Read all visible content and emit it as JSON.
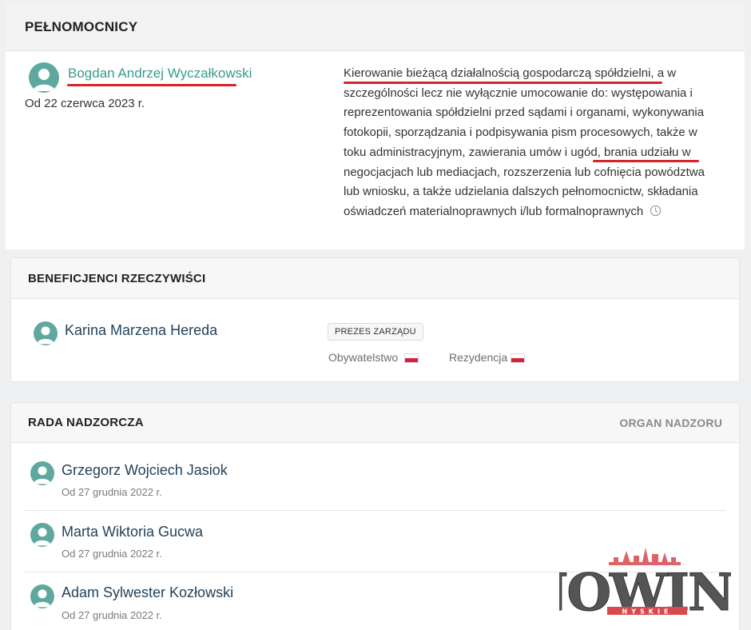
{
  "proxies": {
    "title": "PEŁNOMOCNICY",
    "person": {
      "name": "Bogdan Andrzej Wyczałkowski",
      "since": "Od 22 czerwca 2023 r."
    },
    "scope_parts": [
      "Kierowanie bieżącą działalnością gospodarczą spółdzielni",
      ", a w szczególności lecz nie wyłącznie umocowanie do: występowania i reprezentowania spółdzielni przed sądami i organami, wykonywania fotokopii, sporządzania i podpisywania pism procesowych, także w toku administracyjnym,",
      " zawierania umów i",
      " ugód, brania udziału w negocjacjach lub mediacjach, rozszerzenia lub cofnięcia powództwa lub wniosku, a także udzielania dalszych pełnomocnictw, składania oświadczeń materialnoprawnych i/lub formalnoprawnych"
    ]
  },
  "beneficiaries": {
    "title": "BENEFICJENCI RZECZYWIŚCI",
    "person": {
      "name": "Karina Marzena Hereda",
      "role_badge": "PREZES ZARZĄDU",
      "citizenship_label": "Obywatelstwo",
      "residence_label": "Rezydencja"
    }
  },
  "board": {
    "title": "RADA NADZORCZA",
    "organ_label": "ORGAN NADZORU",
    "members": [
      {
        "name": "Grzegorz Wojciech Jasiok",
        "since": "Od 27 grudnia 2022 r."
      },
      {
        "name": "Marta Wiktoria Gucwa",
        "since": "Od 27 grudnia 2022 r."
      },
      {
        "name": "Adam Sylwester Kozłowski",
        "since": "Od 27 grudnia 2022 r."
      }
    ]
  },
  "watermark": {
    "brand": "NOWINY",
    "sub": "NYSKIE"
  },
  "colors": {
    "accent_link": "#3a9b8f",
    "avatar": "#5fa89f",
    "underline_red": "#d6242b",
    "flag_red": "#d4213d"
  },
  "icons": {
    "avatar": "user-avatar-icon",
    "history": "clock-icon",
    "flag": "poland-flag-icon"
  }
}
